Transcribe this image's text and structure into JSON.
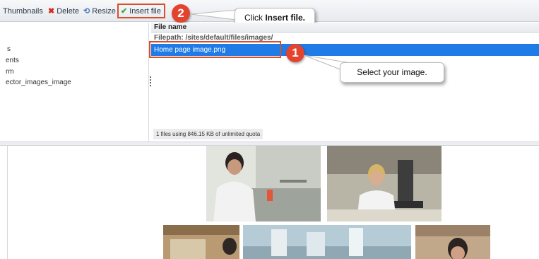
{
  "toolbar": {
    "thumbnails": "Thumbnails",
    "delete": "Delete",
    "resize": "Resize",
    "insert_file": "Insert file"
  },
  "annotations": {
    "step1_number": "1",
    "step2_number": "2",
    "callout_insert_prefix": "Click ",
    "callout_insert_bold": "Insert file.",
    "callout_select": "Select your image."
  },
  "tree": {
    "items": [
      "s",
      "ents",
      "rm",
      "ector_images_image"
    ]
  },
  "file_list": {
    "column_header": "File name",
    "filepath": "Filepath: /sites/default/files/images/",
    "selected_file": "Home page image.png",
    "quota": "1 files using 846.15 KB of unlimited quota"
  },
  "colors": {
    "accent_red": "#d94f2b",
    "selection_blue": "#1f7be6",
    "delete_red": "#d42a1e",
    "insert_green": "#3aa43a"
  },
  "icons": [
    "delete-icon",
    "resize-icon",
    "checkmark-icon"
  ]
}
